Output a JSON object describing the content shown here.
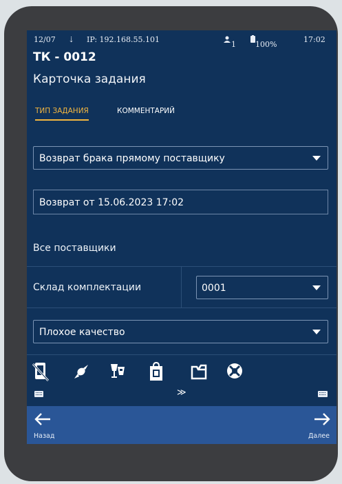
{
  "status_bar": {
    "date": "12/07",
    "wifi_glyph": "⇣",
    "ip": "IP: 192.168.55.101",
    "users": "1",
    "battery": "100%",
    "time": "17:02"
  },
  "header": {
    "title": "ТК - 0012",
    "subtitle": "Карточка задания"
  },
  "tabs": [
    {
      "label": "ТИП ЗАДАНИЯ",
      "active": true
    },
    {
      "label": "КОММЕНТАРИЙ",
      "active": false
    }
  ],
  "form": {
    "task_type": "Возврат брака прямому поставщику",
    "description": "Возврат от 15.06.2023 17:02",
    "suppliers": "Все поставщики",
    "warehouse_label": "Склад комплектации",
    "warehouse_value": "0001",
    "reason": "Плохое качество"
  },
  "toolbar_icons": [
    "no-mobile-icon",
    "candy-icon",
    "drink-icon",
    "shopping-bag-icon",
    "box-icon",
    "lifebuoy-icon"
  ],
  "expand_glyph": "≫",
  "bottom_nav": {
    "back_label": "Назад",
    "next_label": "Далее"
  },
  "colors": {
    "background": "#10325a",
    "accent": "#f3b640",
    "bottom_bar": "#2a5697"
  }
}
